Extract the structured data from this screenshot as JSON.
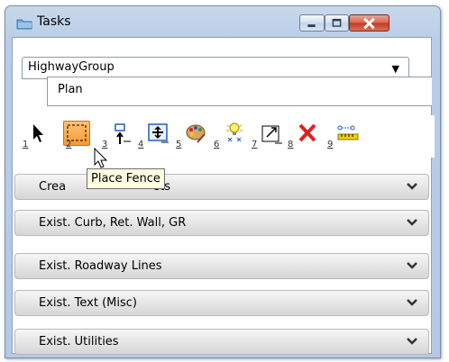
{
  "window": {
    "title": "Tasks",
    "icons": {
      "app": "tasks-folder-icon",
      "minimize": "minimize-icon",
      "maximize": "maximize-icon",
      "close": "close-icon"
    }
  },
  "group_selector": {
    "value": "HighwayGroup",
    "icon": "dropdown-arrow-icon"
  },
  "task_tab": {
    "label": "Plan"
  },
  "toolbar": {
    "tools": [
      {
        "num": "1",
        "icon": "selection-arrow-icon"
      },
      {
        "num": "2",
        "icon": "place-fence-icon",
        "selected": true
      },
      {
        "num": "3",
        "icon": "element-selection-icon"
      },
      {
        "num": "4",
        "icon": "move-icon"
      },
      {
        "num": "5",
        "icon": "palette-icon"
      },
      {
        "num": "6",
        "icon": "lightbulb-icon"
      },
      {
        "num": "7",
        "icon": "scale-icon"
      },
      {
        "num": "8",
        "icon": "delete-icon"
      },
      {
        "num": "9",
        "icon": "measure-icon"
      }
    ],
    "tooltip": "Place Fence"
  },
  "categories": [
    {
      "label": "Crea",
      "label_suffix": "ets",
      "icon": "chevron-down-icon"
    },
    {
      "label": "Exist. Curb, Ret. Wall, GR",
      "icon": "chevron-down-icon"
    },
    {
      "label": "Exist. Roadway Lines",
      "icon": "chevron-down-icon"
    },
    {
      "label": "Exist. Text (Misc)",
      "icon": "chevron-down-icon"
    },
    {
      "label": "Exist. Utilities",
      "icon": "chevron-down-icon"
    }
  ],
  "colors": {
    "accent": "#f59a2c",
    "delete": "#e02020"
  }
}
